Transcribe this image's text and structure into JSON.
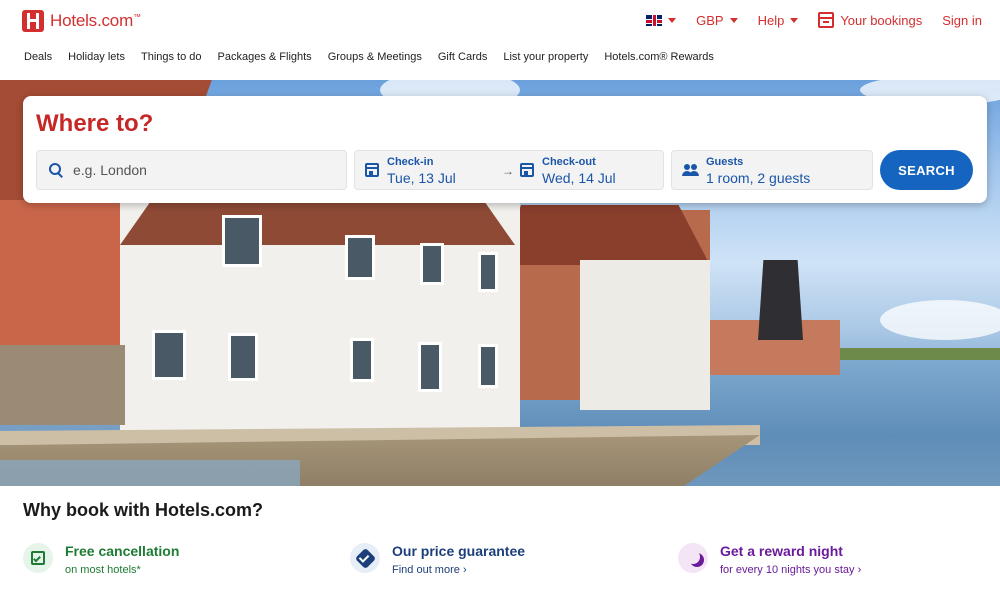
{
  "header": {
    "brand": "Hotels.com",
    "brand_tm": "™",
    "currency": "GBP",
    "help": "Help",
    "bookings": "Your bookings",
    "signin": "Sign in"
  },
  "nav": [
    "Deals",
    "Holiday lets",
    "Things to do",
    "Packages & Flights",
    "Groups & Meetings",
    "Gift Cards",
    "List your property",
    "Hotels.com® Rewards"
  ],
  "search": {
    "title": "Where to?",
    "destination_placeholder": "e.g. London",
    "checkin_label": "Check-in",
    "checkin_value": "Tue, 13 Jul",
    "checkout_label": "Check-out",
    "checkout_value": "Wed, 14 Jul",
    "guests_label": "Guests",
    "guests_value": "1 room, 2 guests",
    "button": "SEARCH"
  },
  "why": {
    "title": "Why book with Hotels.com?",
    "features": [
      {
        "title": "Free cancellation",
        "subtitle": "on most hotels*",
        "color": "#1e7b34",
        "bg": "#e6f4ea",
        "icon": "calendar-check-icon"
      },
      {
        "title": "Our price guarantee",
        "subtitle": "Find out more",
        "color": "#1c3f7a",
        "bg": "#e8eef7",
        "icon": "shield-check-icon"
      },
      {
        "title": "Get a reward night",
        "subtitle": "for every 10 nights you stay",
        "color": "#6a1b9a",
        "bg": "#f3e5f5",
        "icon": "moon-icon"
      }
    ]
  },
  "colors": {
    "brand_red": "#d32f2f",
    "search_blue": "#1565c0"
  }
}
